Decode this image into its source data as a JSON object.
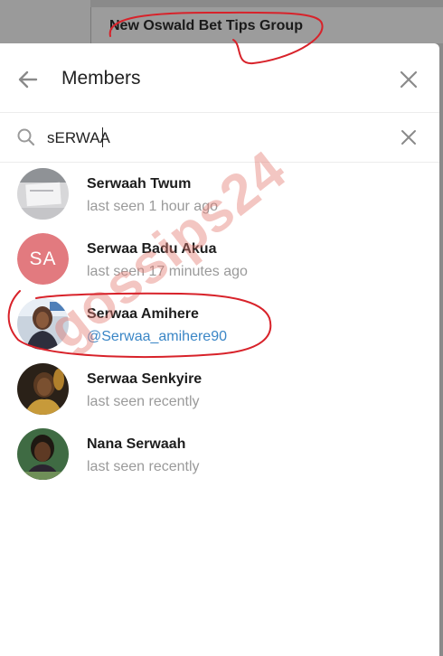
{
  "chat": {
    "title": "New Oswald Bet Tips Group"
  },
  "modal": {
    "title": "Members",
    "back_icon": "arrow-left-icon",
    "close_icon": "close-icon"
  },
  "search": {
    "value": "sERWAA",
    "search_icon": "search-icon",
    "clear_icon": "clear-icon"
  },
  "members": [
    {
      "name": "Serwaah Twum",
      "status": "last seen 1 hour ago",
      "avatar": "photo"
    },
    {
      "name": "Serwaa Badu Akua",
      "status": "last seen 17 minutes ago",
      "avatar": "initials",
      "initials": "SA",
      "avatar_color": "#e27a7f"
    },
    {
      "name": "Serwaa Amihere",
      "status": "@Serwaa_amihere90",
      "avatar": "photo"
    },
    {
      "name": "Serwaa Senkyire",
      "status": "last seen recently",
      "avatar": "photo"
    },
    {
      "name": "Nana Serwaah",
      "status": "last seen recently",
      "avatar": "photo"
    }
  ],
  "watermark": "gossips24",
  "colors": {
    "username_link": "#3a86c6",
    "status_gray": "#9a9a9a",
    "annotation_red": "#d8222a",
    "watermark": "#e2786e"
  }
}
